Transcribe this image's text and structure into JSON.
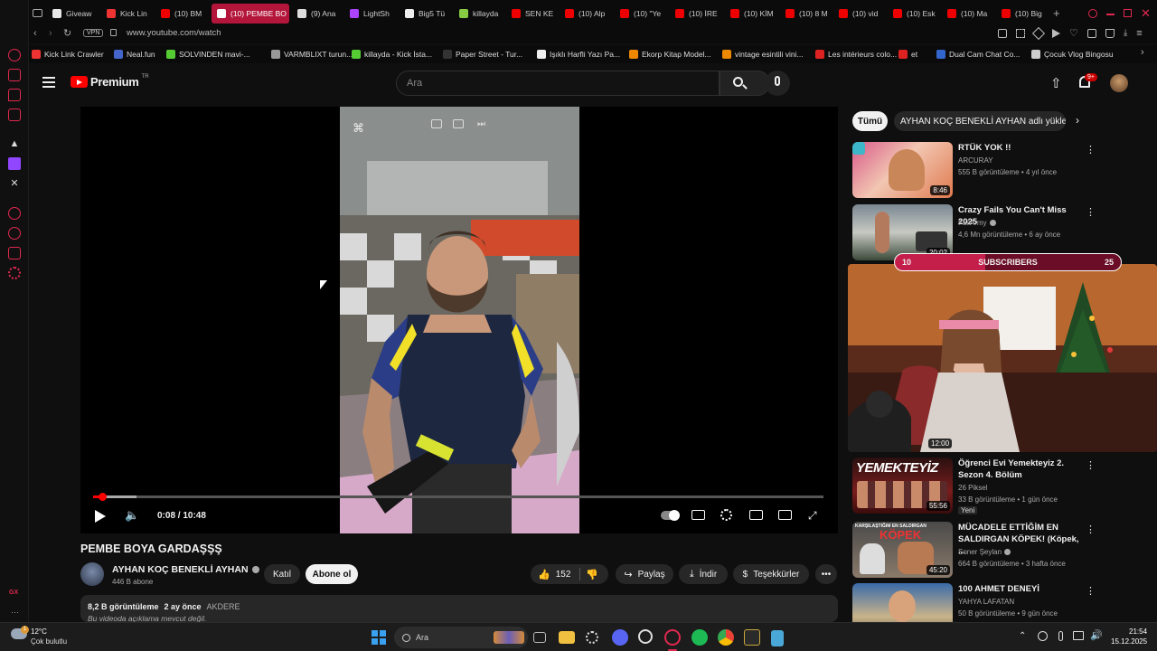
{
  "browser": {
    "tabs": [
      {
        "label": "Giveaw",
        "color": "#e8e8e8"
      },
      {
        "label": "Kick Lin",
        "color": "#e33"
      },
      {
        "label": "(10) BM",
        "color": "#e00"
      },
      {
        "label": "(10) PEMBE BO",
        "color": "#e00"
      },
      {
        "label": "(9) Ana",
        "color": "#ddd"
      },
      {
        "label": "LightSh",
        "color": "#a4f"
      },
      {
        "label": "Big5 Tü",
        "color": "#eee"
      },
      {
        "label": "killayda",
        "color": "#8c4"
      },
      {
        "label": "SEN KE",
        "color": "#e00"
      },
      {
        "label": "(10) Alp",
        "color": "#e00"
      },
      {
        "label": "(10) \"Ye",
        "color": "#e00"
      },
      {
        "label": "(10) İRE",
        "color": "#e00"
      },
      {
        "label": "(10) KİM",
        "color": "#e00"
      },
      {
        "label": "(10) 8 M",
        "color": "#e00"
      },
      {
        "label": "(10) vid",
        "color": "#e00"
      },
      {
        "label": "(10) Esk",
        "color": "#e00"
      },
      {
        "label": "(10) Ma",
        "color": "#e00"
      },
      {
        "label": "(10) Big",
        "color": "#e00"
      }
    ],
    "new_tab": "+",
    "vpn_label": "VPN",
    "url": "www.youtube.com/watch",
    "bookmarks": [
      {
        "label": "Kick Link Crawler",
        "color": "#e33"
      },
      {
        "label": "Neal.fun",
        "color": "#46c"
      },
      {
        "label": "SOLVINDEN mavi-...",
        "color": "#5c3"
      },
      {
        "label": "VARMBLIXT turun...",
        "color": "#999"
      },
      {
        "label": "killayda - Kick İsta...",
        "color": "#5c3"
      },
      {
        "label": "Paper Street - Tur...",
        "color": "#333"
      },
      {
        "label": "Işıklı Harfli Yazı Pa...",
        "color": "#eee"
      },
      {
        "label": "Ekorp Kitap Model...",
        "color": "#e80"
      },
      {
        "label": "vintage esintili vini...",
        "color": "#e80"
      },
      {
        "label": "Les intérieurs colo...",
        "color": "#d22"
      },
      {
        "label": "et",
        "color": "#d22"
      },
      {
        "label": "Dual Cam Chat Co...",
        "color": "#36c"
      },
      {
        "label": "Çocuk Vlog Bingosu",
        "color": "#ccc"
      }
    ]
  },
  "youtube": {
    "logo_text": "Premium",
    "logo_region": "TR",
    "search_placeholder": "Ara",
    "notification_count": "9+",
    "player": {
      "time": "0:08 / 10:48",
      "progress": 0.012,
      "buffered": 0.06
    },
    "video": {
      "title": "PEMBE BOYA GARDAŞŞŞ",
      "channel": "AYHAN KOÇ BENEKLİ AYHAN",
      "subscribers": "446 B abone",
      "join_label": "Katıl",
      "subscribe_label": "Abone ol",
      "likes": "152",
      "share_label": "Paylaş",
      "download_label": "İndir",
      "thanks_label": "Teşekkürler",
      "views": "8,2 B görüntüleme",
      "age": "2 ay önce",
      "tag": "AKDERE",
      "description": "Bu videoda açıklama mevcut değil."
    },
    "filter_chips": [
      "Tümü",
      "AYHAN KOÇ BENEKLİ AYHAN adlı yükleyic"
    ],
    "overlay": {
      "left_count": "10",
      "label": "SUBSCRIBERS",
      "right_count": "25",
      "duration": "12:00"
    },
    "recommendations": [
      {
        "title": "RTÜK YOK !!",
        "channel": "ARCURAY",
        "meta": "555 B görüntüleme • 4 yıl önce",
        "duration": "8:46"
      },
      {
        "title": "Crazy Fails You Can't Miss 2025",
        "channel": "FailArmy",
        "meta": "4,6 Mn görüntüleme • 6 ay önce",
        "duration": "20:02"
      },
      {
        "title": "Öğrenci Evi Yemekteyiz 2. Sezon 4. Bölüm",
        "channel": "26 Piksel",
        "meta": "33 B görüntüleme • 1 gün önce",
        "badge": "Yeni",
        "duration": "55:56",
        "thumb_text": "YEMEKTEYİZ"
      },
      {
        "title": "MÜCADELE ETTİĞİM EN SALDIRGAN KÖPEK! (Köpek, ...",
        "channel": "Soner Şeylan",
        "meta": "664 B görüntüleme • 3 hafta önce",
        "duration": "45:20",
        "thumb_text_top": "KARŞILAŞTIĞIM EN SALDIRGAN",
        "thumb_text": "KÖPEK"
      },
      {
        "title": "100 AHMET DENEYİ",
        "channel": "YAHYA LAFATAN",
        "meta": "50 B görüntüleme • 9 gün önce",
        "duration": ""
      }
    ]
  },
  "taskbar": {
    "weather_temp": "12°C",
    "weather_desc": "Çok bulutlu",
    "search_placeholder": "Ara",
    "time": "21:54",
    "date": "15.12.2025",
    "badge": "1"
  },
  "sidebar_label": "GX"
}
